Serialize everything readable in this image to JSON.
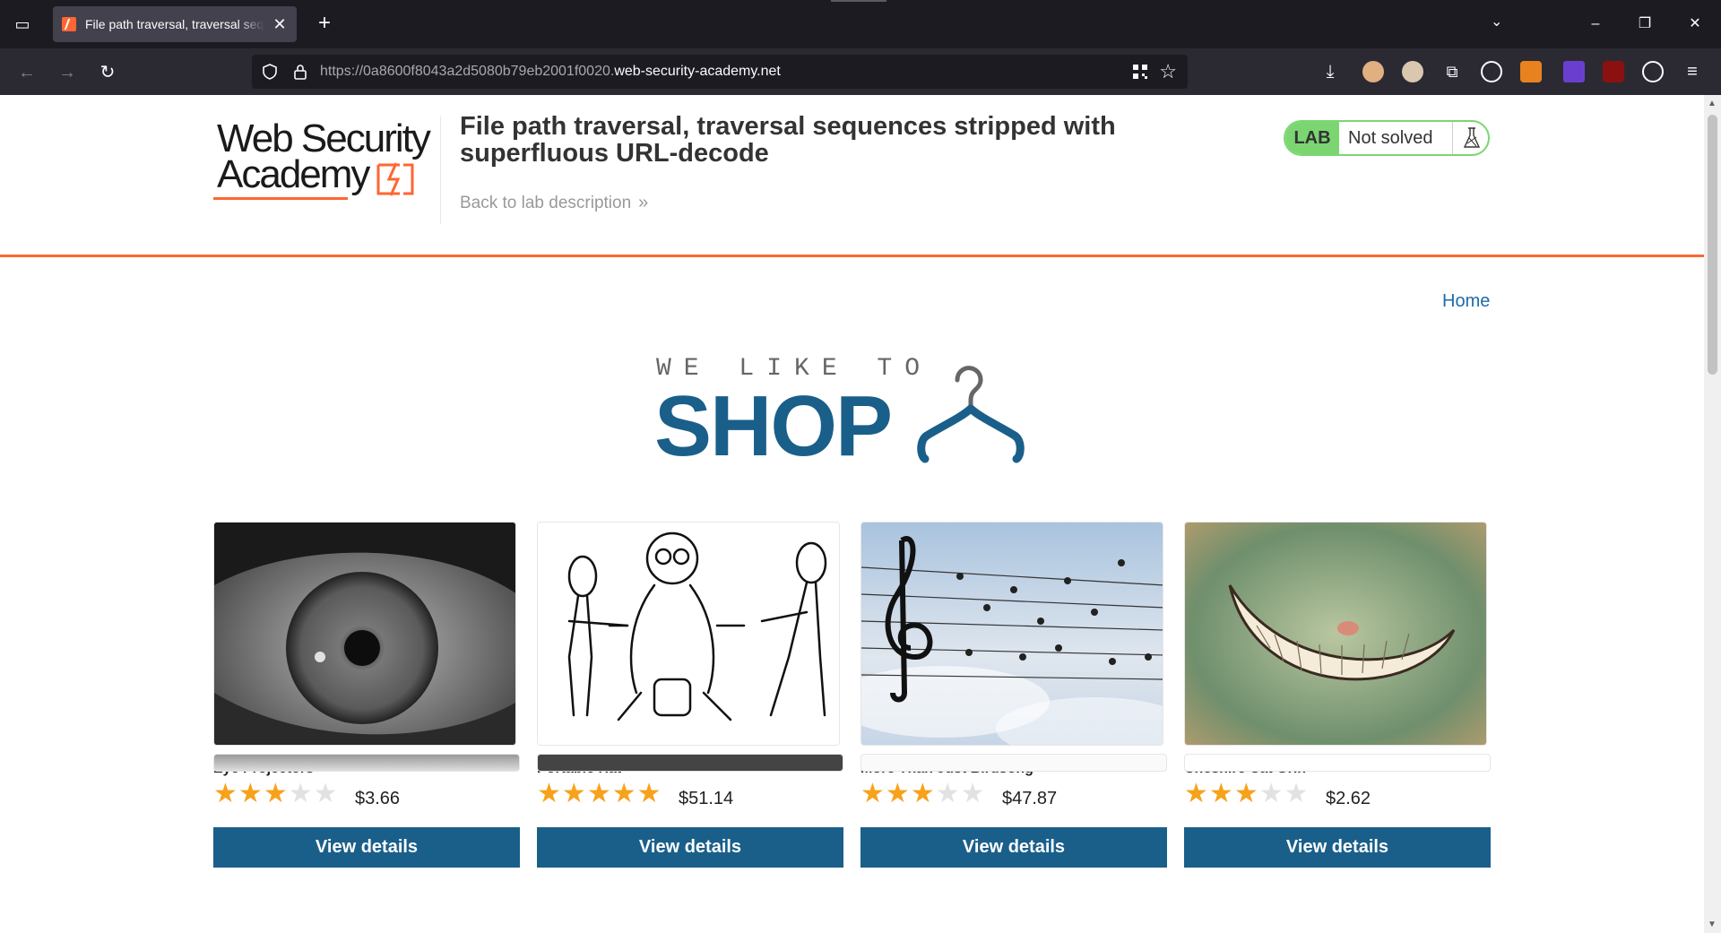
{
  "browser": {
    "tab_title": "File path traversal, traversal seq",
    "url_prefix": "https://0a8600f8043a2d5080b79eb2001f0020.",
    "url_domain": "web-security-academy.net"
  },
  "header": {
    "logo_line1": "Web Security",
    "logo_line2": "Academy",
    "title": "File path traversal, traversal sequences stripped with superfluous URL-decode",
    "back_link": "Back to lab description",
    "lab_badge": "LAB",
    "status": "Not solved"
  },
  "nav": {
    "home": "Home"
  },
  "banner": {
    "we_like_to": "WE LIKE TO",
    "shop": "SHOP"
  },
  "colors": {
    "accent": "#ff6633",
    "primary_blue": "#1a5f8a",
    "lab_green": "#7bd672",
    "star": "#f7a21b"
  },
  "products": [
    {
      "name": "Eye Projectors",
      "rating": 3,
      "price": "$3.66",
      "button": "View details"
    },
    {
      "name": "Portable Hat",
      "rating": 5,
      "price": "$51.14",
      "button": "View details"
    },
    {
      "name": "More Than Just Birdsong",
      "rating": 3,
      "price": "$47.87",
      "button": "View details"
    },
    {
      "name": "Cheshire Cat Grin",
      "rating": 3,
      "price": "$2.62",
      "button": "View details"
    }
  ]
}
